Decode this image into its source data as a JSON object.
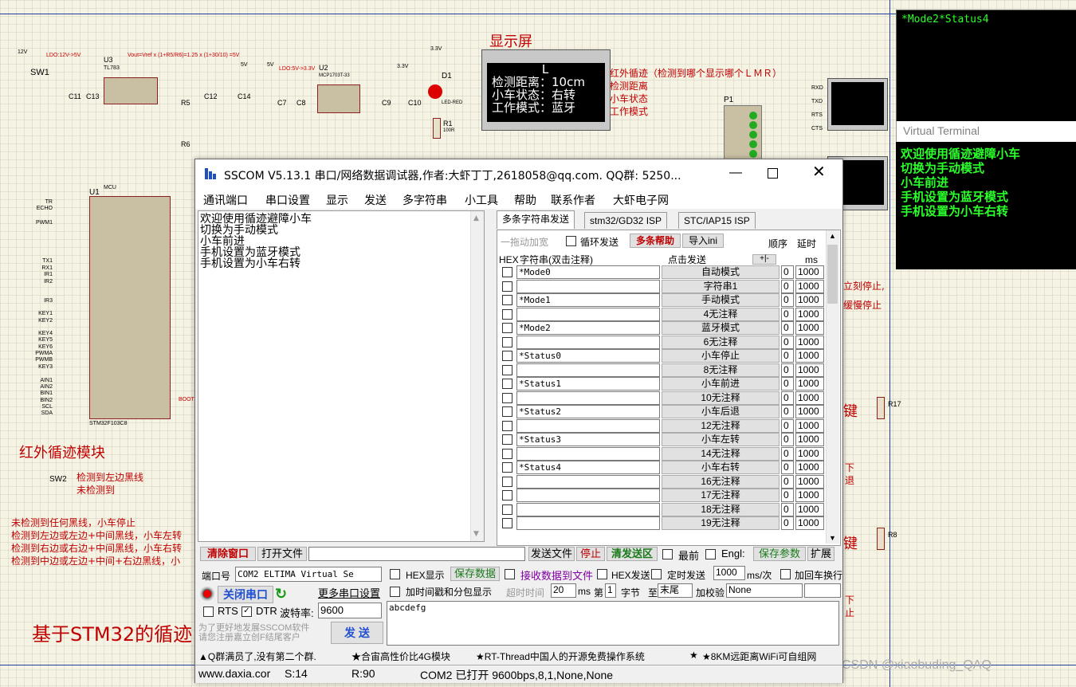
{
  "schematic": {
    "display_title": "显示屏",
    "lcd_lines": [
      "L",
      "检测距离：10cm",
      "小车状态：右转",
      "工作模式：蓝牙"
    ],
    "ir_note_lines": [
      "红外循迹（检测到哪个显示哪个ＬＭＲ）",
      "检测距离",
      "小车状态",
      "工作模式"
    ],
    "ir_module_title": "红外循迹模块",
    "sw2_labels": [
      "检测到左边黑线",
      "未检测到"
    ],
    "ir_rules": [
      "未检测到任何黑线，小车停止",
      "检测到左边或左边+中间黑线，小车左转",
      "检测到右边或右边+中间黑线，小车右转",
      "检测到中边或左边+中间+右边黑线，小"
    ],
    "big_title": "基于STM32的循迹",
    "right_notes": [
      "立刻停止,",
      "缓慢停止"
    ],
    "key_labels": [
      "键",
      "键"
    ],
    "under_labels": [
      "下",
      "退",
      "下",
      "止"
    ],
    "mcu_name": "STM32F103C8",
    "mcu_ref": "U1",
    "mcu_header": "MCU",
    "left_pins": [
      "TR",
      "ECHO",
      "PWM1",
      "TX1",
      "RX1",
      "IR1",
      "IR2",
      "IR3",
      "KEY1",
      "KEY2",
      "KEY4",
      "KEY5",
      "KEY6",
      "PWMA",
      "PWMB",
      "KEY3",
      "AIN1",
      "AIN2",
      "BIN1",
      "BIN2",
      "SCL",
      "SDA"
    ],
    "components": {
      "u3": "U3",
      "u3_part": "TL783",
      "u2": "U2",
      "u2_part": "MCP1703T-33",
      "d1": "D1",
      "d1_part": "LED-RED",
      "r1": "R1",
      "r1_val": "100R",
      "r5": "R5",
      "r6": "R6",
      "c11": "C11",
      "c13": "C13",
      "c12": "C12",
      "c14": "C14",
      "c7": "C7",
      "c8": "C8",
      "c9": "C9",
      "c10": "C10",
      "sw1": "SW1",
      "sw2": "SW2",
      "p1": "P1",
      "r17": "R17",
      "r8": "R8",
      "v12": "12V",
      "v5": "5V",
      "v33": "3.3V",
      "ldo1": "LDO:12V->5V",
      "ldo2": "LDO:5V->3.3V",
      "vout": "Vout=Vref x (1+R5/R6)=1.25 x (1+30/10) =5V"
    },
    "watermark": "CSDN @xiaobuding_QAQ"
  },
  "vterm1": {
    "line": "*Mode2*Status4",
    "pins": [
      "RXD",
      "TXD",
      "RTS",
      "CTS"
    ]
  },
  "vterm2": {
    "title": "Virtual Terminal",
    "lines": [
      "欢迎使用循迹避障小车",
      "切换为手动模式",
      "小车前进",
      "手机设置为蓝牙模式",
      "手机设置为小车右转"
    ]
  },
  "sscom": {
    "title": "SSCOM V5.13.1 串口/网络数据调试器,作者:大虾丁丁,2618058@qq.com. QQ群: 5250...",
    "menu": [
      "通讯端口",
      "串口设置",
      "显示",
      "发送",
      "多字符串",
      "小工具",
      "帮助",
      "联系作者",
      "大虾电子网"
    ],
    "receive_lines": [
      "欢迎使用循迹避障小车",
      "切换为手动模式",
      "小车前进",
      "手机设置为蓝牙模式",
      "手机设置为小车右转"
    ],
    "tabs": [
      "多条字符串发送",
      "stm32/GD32 ISP",
      "STC/IAP15 ISP"
    ],
    "grid_toolbar": {
      "drag": "一拖动加宽",
      "loop_send": "循环发送",
      "multi_help": "多条帮助",
      "import": "导入ini",
      "order": "顺序",
      "delay": "延时"
    },
    "grid_header": {
      "hex": "HEX",
      "string": "字符串(双击注释)",
      "click_send": "点击发送",
      "pm": "+|-",
      "ms": "ms"
    },
    "rows": [
      {
        "str": "*Mode0",
        "btn": "自动模式",
        "order": "0",
        "delay": "1000"
      },
      {
        "str": "",
        "btn": "字符串1",
        "order": "0",
        "delay": "1000"
      },
      {
        "str": "*Mode1",
        "btn": "手动模式",
        "order": "0",
        "delay": "1000"
      },
      {
        "str": "",
        "btn": "4无注释",
        "order": "0",
        "delay": "1000"
      },
      {
        "str": "*Mode2",
        "btn": "蓝牙模式",
        "order": "0",
        "delay": "1000"
      },
      {
        "str": "",
        "btn": "6无注释",
        "order": "0",
        "delay": "1000"
      },
      {
        "str": "*Status0",
        "btn": "小车停止",
        "order": "0",
        "delay": "1000"
      },
      {
        "str": "",
        "btn": "8无注释",
        "order": "0",
        "delay": "1000"
      },
      {
        "str": "*Status1",
        "btn": "小车前进",
        "order": "0",
        "delay": "1000"
      },
      {
        "str": "",
        "btn": "10无注释",
        "order": "0",
        "delay": "1000"
      },
      {
        "str": "*Status2",
        "btn": "小车后退",
        "order": "0",
        "delay": "1000"
      },
      {
        "str": "",
        "btn": "12无注释",
        "order": "0",
        "delay": "1000"
      },
      {
        "str": "*Status3",
        "btn": "小车左转",
        "order": "0",
        "delay": "1000"
      },
      {
        "str": "",
        "btn": "14无注释",
        "order": "0",
        "delay": "1000"
      },
      {
        "str": "*Status4",
        "btn": "小车右转",
        "order": "0",
        "delay": "1000"
      },
      {
        "str": "",
        "btn": "16无注释",
        "order": "0",
        "delay": "1000"
      },
      {
        "str": "",
        "btn": "17无注释",
        "order": "0",
        "delay": "1000"
      },
      {
        "str": "",
        "btn": "18无注释",
        "order": "0",
        "delay": "1000"
      },
      {
        "str": "",
        "btn": "19无注释",
        "order": "0",
        "delay": "1000"
      }
    ],
    "bottom": {
      "clear": "清除窗口",
      "open_file": "打开文件",
      "send_file": "发送文件",
      "stop": "停止",
      "clear_send": "清发送区",
      "top": "最前",
      "english": "Engl:",
      "save_params": "保存参数",
      "expand": "扩展",
      "port_label": "端口号",
      "port_value": "COM2 ELTIMA Virtual Se",
      "hex_display": "HEX显示",
      "save_data": "保存数据",
      "recv_to_file": "接收数据到文件",
      "hex_send": "HEX发送",
      "timed_send": "定时发送",
      "interval": "1000",
      "interval_unit": "ms/次",
      "add_crlf": "加回车换行",
      "close_port": "关闭串口",
      "more_settings": "更多串口设置",
      "timestamp": "加时间戳和分包显示",
      "timeout_label": "超时时间",
      "timeout": "20",
      "ms": "ms",
      "nth": "第",
      "byte_no": "1",
      "byte": "字节",
      "to": "至",
      "end": "末尾",
      "checksum": "加校验",
      "checksum_val": "None",
      "rts": "RTS",
      "dtr": "DTR",
      "baud_label": "波特率:",
      "baud": "9600",
      "send_text": "abcdefg",
      "promo": "为了更好地发展SSCOM软件\n请您注册嘉立创F结尾客户",
      "send": "发 送"
    },
    "ticker": [
      "▲Q群满员了,没有第二个群.",
      "★合宙高性价比4G模块",
      "★RT-Thread中国人的开源免费操作系统",
      "★",
      "★8KM远距离WiFi可自组网"
    ],
    "status": {
      "site": "www.daxia.cor",
      "s": "S:14",
      "r": "R:90",
      "port": "COM2 已打开  9600bps,8,1,None,None"
    }
  }
}
